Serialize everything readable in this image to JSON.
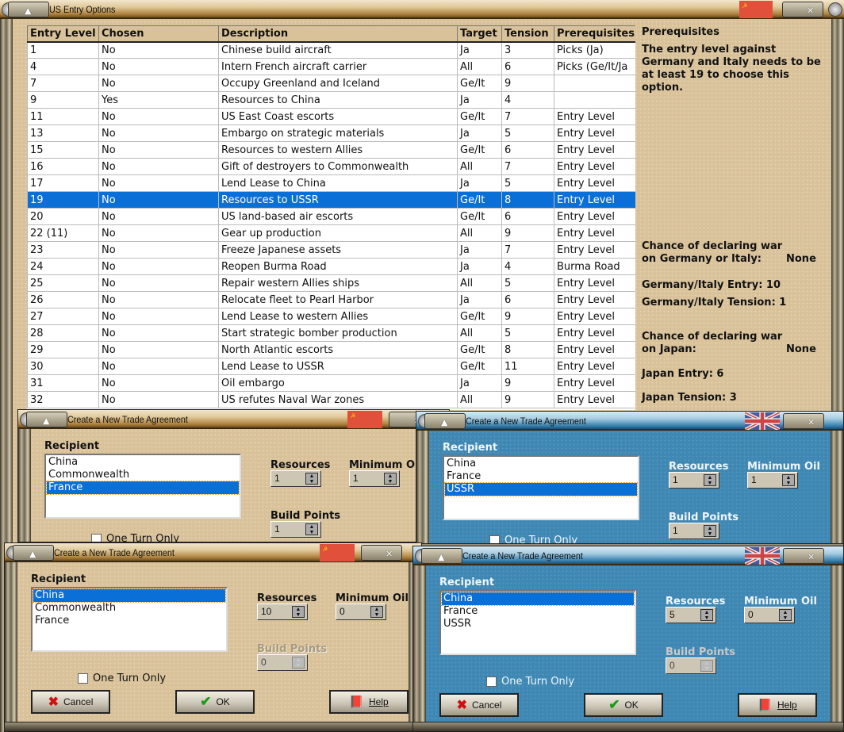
{
  "main": {
    "title": "US Entry Options",
    "columns": [
      "Entry Level",
      "Chosen",
      "Description",
      "Target",
      "Tension",
      "Prerequisites"
    ],
    "rows": [
      [
        "1",
        "No",
        "Chinese build aircraft",
        "Ja",
        "3",
        "Picks (Ja)"
      ],
      [
        "4",
        "No",
        "Intern French aircraft carrier",
        "All",
        "6",
        "Picks (Ge/It/Ja"
      ],
      [
        "7",
        "No",
        "Occupy Greenland and Iceland",
        "Ge/It",
        "9",
        ""
      ],
      [
        "9",
        "Yes",
        "Resources to China",
        "Ja",
        "4",
        ""
      ],
      [
        "11",
        "No",
        "US East Coast escorts",
        "Ge/It",
        "7",
        "Entry Level"
      ],
      [
        "13",
        "No",
        "Embargo on strategic materials",
        "Ja",
        "5",
        "Entry Level"
      ],
      [
        "15",
        "No",
        "Resources to western Allies",
        "Ge/It",
        "6",
        "Entry Level"
      ],
      [
        "16",
        "No",
        "Gift of destroyers to Commonwealth",
        "All",
        "7",
        "Entry Level"
      ],
      [
        "17",
        "No",
        "Lend Lease to China",
        "Ja",
        "5",
        "Entry Level"
      ],
      [
        "19",
        "No",
        "Resources to USSR",
        "Ge/It",
        "8",
        "Entry Level"
      ],
      [
        "20",
        "No",
        "US land-based air escorts",
        "Ge/It",
        "6",
        "Entry Level"
      ],
      [
        "22 (11)",
        "No",
        "Gear up production",
        "All",
        "9",
        "Entry Level"
      ],
      [
        "23",
        "No",
        "Freeze Japanese assets",
        "Ja",
        "7",
        "Entry Level"
      ],
      [
        "24",
        "No",
        "Reopen Burma Road",
        "Ja",
        "4",
        "Burma Road"
      ],
      [
        "25",
        "No",
        "Repair western Allies ships",
        "All",
        "5",
        "Entry Level"
      ],
      [
        "26",
        "No",
        "Relocate fleet to Pearl Harbor",
        "Ja",
        "6",
        "Entry Level"
      ],
      [
        "27",
        "No",
        "Lend Lease to western Allies",
        "Ge/It",
        "9",
        "Entry Level"
      ],
      [
        "28",
        "No",
        "Start strategic bomber production",
        "All",
        "5",
        "Entry Level"
      ],
      [
        "29",
        "No",
        "North Atlantic escorts",
        "Ge/It",
        "8",
        "Entry Level"
      ],
      [
        "30",
        "No",
        "Lend Lease to USSR",
        "Ge/It",
        "11",
        "Entry Level"
      ],
      [
        "31",
        "No",
        "Oil embargo",
        "Ja",
        "9",
        "Entry Level"
      ],
      [
        "32",
        "No",
        "US refutes Naval War zones",
        "All",
        "9",
        "Entry Level"
      ]
    ],
    "selected_row": 9,
    "panel": {
      "heading": "Prerequisites",
      "text": "The entry level against Germany and Italy needs to be at least 19 to choose this option.",
      "chance_gi_label": "Chance of declaring war on Germany or Italy:",
      "chance_gi_value": "None",
      "gi_entry": "Germany/Italy Entry: 10",
      "gi_tension": "Germany/Italy Tension: 1",
      "chance_ja_label": "Chance of declaring war on Japan:",
      "chance_ja_value": "None",
      "ja_entry": "Japan Entry: 6",
      "ja_tension": "Japan Tension: 3"
    }
  },
  "dialogs": [
    {
      "title": "Create a New Trade Agreement",
      "theme": "tan",
      "flag": "ussr",
      "recipient_label": "Recipient",
      "recipients": [
        "China",
        "Commonwealth",
        "France"
      ],
      "selected": 2,
      "resources_label": "Resources",
      "resources": "1",
      "min_oil_label": "Minimum Oil",
      "min_oil": "1",
      "build_points_label": "Build Points",
      "build_points": "1",
      "one_turn_label": "One Turn Only"
    },
    {
      "title": "Create a New Trade Agreement",
      "theme": "blue",
      "flag": "uk",
      "recipient_label": "Recipient",
      "recipients": [
        "China",
        "France",
        "USSR"
      ],
      "selected": 2,
      "resources_label": "Resources",
      "resources": "1",
      "min_oil_label": "Minimum Oil",
      "min_oil": "1",
      "build_points_label": "Build Points",
      "build_points": "1",
      "one_turn_label": "One Turn Only"
    },
    {
      "title": "Create a New Trade Agreement",
      "theme": "tan",
      "flag": "ussr",
      "recipient_label": "Recipient",
      "recipients": [
        "China",
        "Commonwealth",
        "France"
      ],
      "selected": 0,
      "resources_label": "Resources",
      "resources": "10",
      "min_oil_label": "Minimum Oil",
      "min_oil": "0",
      "build_points_label": "Build Points",
      "build_points": "0",
      "one_turn_label": "One Turn Only",
      "cancel": "Cancel",
      "ok": "OK",
      "help": "Help"
    },
    {
      "title": "Create a New Trade Agreement",
      "theme": "blue",
      "flag": "uk",
      "recipient_label": "Recipient",
      "recipients": [
        "China",
        "France",
        "USSR"
      ],
      "selected": 0,
      "resources_label": "Resources",
      "resources": "5",
      "min_oil_label": "Minimum Oil",
      "min_oil": "0",
      "build_points_label": "Build Points",
      "build_points": "0",
      "one_turn_label": "One Turn Only",
      "cancel": "Cancel",
      "ok": "OK",
      "help": "Help"
    }
  ],
  "colors": {
    "selection": "#0a6fd6",
    "tan": "#d9c29a",
    "blue": "#3f88b4",
    "ussr_red": "#e0503a"
  }
}
